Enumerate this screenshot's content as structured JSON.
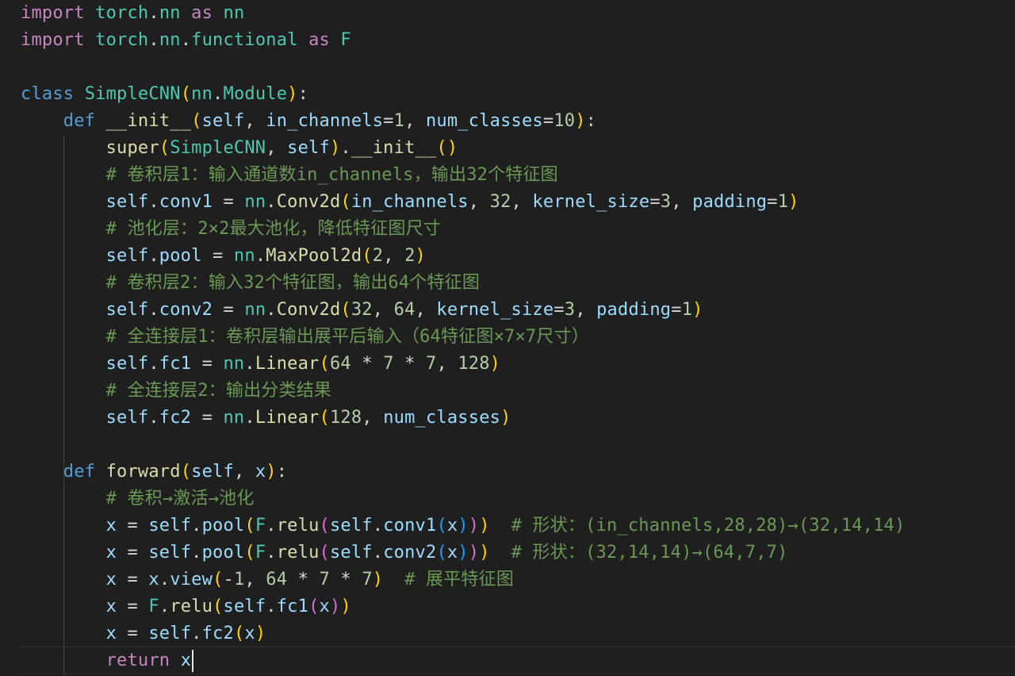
{
  "editor": {
    "language": "python",
    "theme": {
      "background": "#1f1f1f",
      "keyword_control": "#c586c0",
      "keyword_storage": "#569cd6",
      "class_name": "#4ec9b0",
      "function_name": "#dcdcaa",
      "variable": "#9cdcfe",
      "number": "#b5cea8",
      "comment": "#6a9955",
      "bracket_level_1": "#ffd700",
      "bracket_level_2": "#da70d6",
      "bracket_level_3": "#179fff",
      "default_text": "#d4d4d4"
    },
    "cursor_line_number": 25,
    "lines": [
      "import torch.nn as nn",
      "import torch.nn.functional as F",
      "",
      "class SimpleCNN(nn.Module):",
      "    def __init__(self, in_channels=1, num_classes=10):",
      "        super(SimpleCNN, self).__init__()",
      "        # 卷积层1：输入通道数in_channels，输出32个特征图",
      "        self.conv1 = nn.Conv2d(in_channels, 32, kernel_size=3, padding=1)",
      "        # 池化层：2×2最大池化，降低特征图尺寸",
      "        self.pool = nn.MaxPool2d(2, 2)",
      "        # 卷积层2：输入32个特征图，输出64个特征图",
      "        self.conv2 = nn.Conv2d(32, 64, kernel_size=3, padding=1)",
      "        # 全连接层1：卷积层输出展平后输入（64特征图×7×7尺寸）",
      "        self.fc1 = nn.Linear(64 * 7 * 7, 128)",
      "        # 全连接层2：输出分类结果",
      "        self.fc2 = nn.Linear(128, num_classes)",
      "",
      "    def forward(self, x):",
      "        # 卷积→激活→池化",
      "        x = self.pool(F.relu(self.conv1(x)))  # 形状：(in_channels,28,28)→(32,14,14)",
      "        x = self.pool(F.relu(self.conv2(x)))  # 形状：(32,14,14)→(64,7,7)",
      "        x = x.view(-1, 64 * 7 * 7)  # 展平特征图",
      "        x = F.relu(self.fc1(x))",
      "        x = self.fc2(x)",
      "        return x"
    ]
  }
}
